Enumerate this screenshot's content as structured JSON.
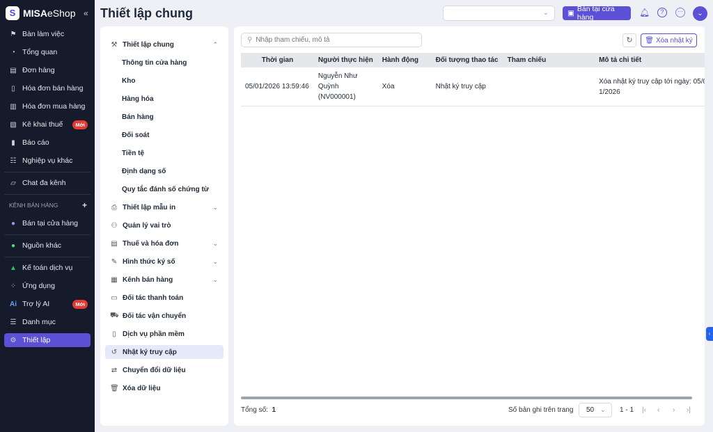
{
  "brand": {
    "mark": "S",
    "name_bold": "MISA",
    "name_light": "eShop"
  },
  "sidebar": {
    "items": [
      {
        "label": "Bàn làm việc",
        "icon": "flag-icon"
      },
      {
        "label": "Tổng quan",
        "icon": "gauge-icon"
      },
      {
        "label": "Đơn hàng",
        "icon": "order-icon"
      },
      {
        "label": "Hóa đơn bán hàng",
        "icon": "invoice-icon"
      },
      {
        "label": "Hóa đơn mua hàng",
        "icon": "purchase-icon"
      },
      {
        "label": "Kê khai thuế",
        "icon": "tax-icon",
        "badge": "Mới"
      },
      {
        "label": "Báo cáo",
        "icon": "chart-icon"
      },
      {
        "label": "Nghiệp vụ khác",
        "icon": "list-icon"
      },
      {
        "label": "Chat đa kênh",
        "icon": "chat-icon"
      },
      {
        "label": "Bán tại cửa hàng",
        "icon": "store-icon"
      },
      {
        "label": "Nguồn khác",
        "icon": "cart-icon"
      },
      {
        "label": "Kế toán dịch vụ",
        "icon": "accounting-icon"
      },
      {
        "label": "Ứng dụng",
        "icon": "apps-icon"
      },
      {
        "label": "Trợ lý AI",
        "icon": "ai-icon",
        "badge": "Mới"
      },
      {
        "label": "Danh mục",
        "icon": "catalog-icon"
      },
      {
        "label": "Thiết lập",
        "icon": "gear-icon"
      }
    ],
    "section": "KÊNH BÁN HÀNG"
  },
  "header": {
    "title": "Thiết lập chung",
    "store_button": "Bán tại cửa hàng"
  },
  "settings_menu": [
    {
      "label": "Thiết lập chung"
    },
    {
      "label": "Thông tin cửa hàng"
    },
    {
      "label": "Kho"
    },
    {
      "label": "Hàng hóa"
    },
    {
      "label": "Bán hàng"
    },
    {
      "label": "Đối soát"
    },
    {
      "label": "Tiền tệ"
    },
    {
      "label": "Định dạng số"
    },
    {
      "label": "Quy tắc đánh số chứng từ"
    },
    {
      "label": "Thiết lập mẫu in"
    },
    {
      "label": "Quản lý vai trò"
    },
    {
      "label": "Thuế và hóa đơn"
    },
    {
      "label": "Hình thức ký số"
    },
    {
      "label": "Kênh bán hàng"
    },
    {
      "label": "Đối tác thanh toán"
    },
    {
      "label": "Đối tác vận chuyển"
    },
    {
      "label": "Dịch vụ phần mềm"
    },
    {
      "label": "Nhật ký truy cập"
    },
    {
      "label": "Chuyển đổi dữ liệu"
    },
    {
      "label": "Xóa dữ liệu"
    }
  ],
  "main": {
    "search_placeholder": "Nhập tham chiếu, mô tả",
    "clear_button": "Xóa nhật ký",
    "columns": [
      "Thời gian",
      "Người thực hiện",
      "Hành động",
      "Đối tượng thao tác",
      "Tham chiếu",
      "Mô tả chi tiết"
    ],
    "rows": [
      [
        "05/01/2026 13:59:46",
        "Nguyễn Như Quỳnh (NV000001)",
        "Xóa",
        "Nhật ký truy cập",
        "",
        "Xóa nhật ký truy cập tới ngày: 05/01/2026"
      ]
    ],
    "total_label": "Tổng số:",
    "total": "1",
    "page_size_label": "Số bản ghi trên trang",
    "page_size": "50",
    "range": "1 - 1"
  },
  "colors": {
    "accent": "#5b50d6",
    "sidebar": "#161b2c"
  }
}
